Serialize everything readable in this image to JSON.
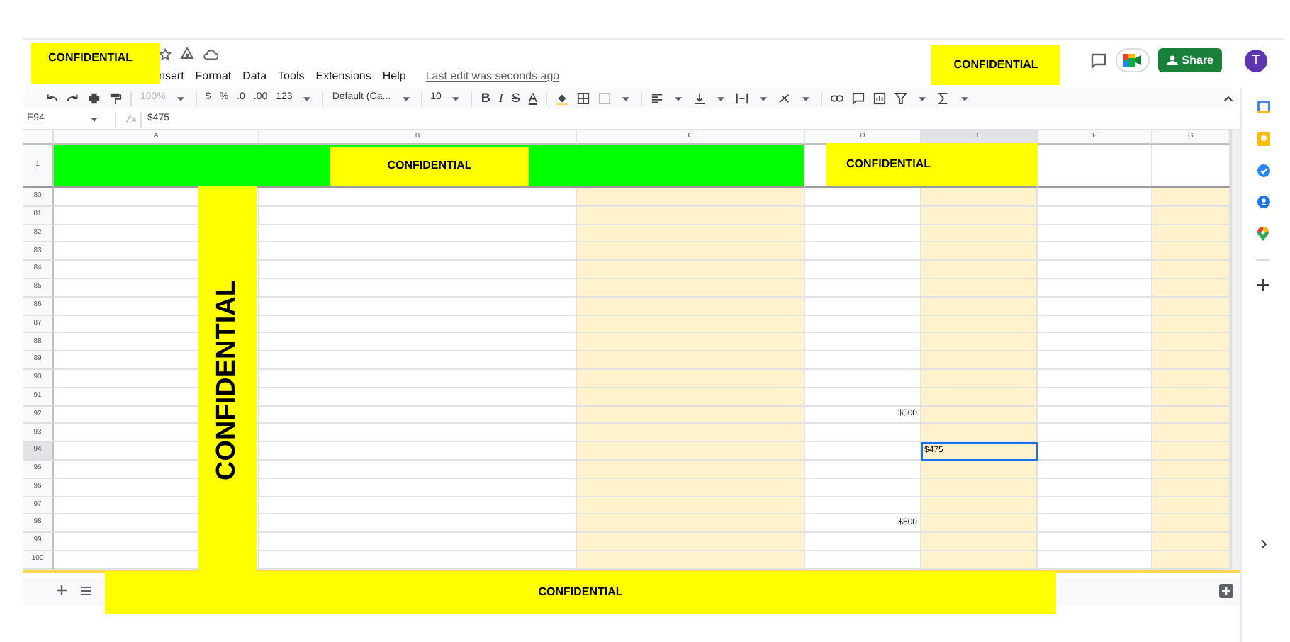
{
  "menu": [
    "nsert",
    "Format",
    "Data",
    "Tools",
    "Extensions",
    "Help"
  ],
  "last_edit": "Last edit was seconds ago",
  "share_button": "Share",
  "avatar": "T",
  "toolbar": {
    "zoom": "100%",
    "currency": "$",
    "percent": "%",
    "decrease_decimals": ".0",
    "increase_decimals": ".00",
    "number_format": "123",
    "font": "Default (Ca...",
    "font_size": "10",
    "bold": "B",
    "italic": "I",
    "strikethrough": "S",
    "text_color": "A"
  },
  "name_box": "E94",
  "formula": "$475",
  "columns": [
    {
      "label": "A",
      "color": "#ffffff",
      "selected": false
    },
    {
      "label": "B",
      "color": "#ffffff",
      "selected": false
    },
    {
      "label": "C",
      "color": "#fff2cc",
      "selected": false
    },
    {
      "label": "D",
      "color": "#ffffff",
      "selected": false
    },
    {
      "label": "E",
      "color": "#fff2cc",
      "selected": true
    },
    {
      "label": "F",
      "color": "#ffffff",
      "selected": false
    },
    {
      "label": "G",
      "color": "#fff2cc",
      "selected": false
    }
  ],
  "title_row": {
    "number": "1",
    "color": "#00ff00"
  },
  "rows": [
    {
      "number": "80",
      "selected": false,
      "cells": [
        {},
        {},
        {},
        {},
        {},
        {},
        {}
      ]
    },
    {
      "number": "81",
      "selected": false,
      "cells": [
        {},
        {},
        {},
        {},
        {},
        {},
        {}
      ]
    },
    {
      "number": "82",
      "selected": false,
      "cells": [
        {},
        {},
        {},
        {},
        {},
        {},
        {}
      ]
    },
    {
      "number": "83",
      "selected": false,
      "cells": [
        {},
        {},
        {},
        {},
        {},
        {},
        {}
      ]
    },
    {
      "number": "84",
      "selected": false,
      "cells": [
        {},
        {},
        {},
        {},
        {},
        {},
        {}
      ]
    },
    {
      "number": "85",
      "selected": false,
      "cells": [
        {},
        {},
        {},
        {},
        {},
        {},
        {}
      ]
    },
    {
      "number": "86",
      "selected": false,
      "cells": [
        {},
        {},
        {},
        {},
        {},
        {},
        {}
      ]
    },
    {
      "number": "87",
      "selected": false,
      "cells": [
        {},
        {},
        {},
        {},
        {},
        {},
        {}
      ]
    },
    {
      "number": "88",
      "selected": false,
      "cells": [
        {},
        {},
        {},
        {},
        {},
        {},
        {}
      ]
    },
    {
      "number": "89",
      "selected": false,
      "cells": [
        {},
        {},
        {},
        {},
        {},
        {},
        {}
      ]
    },
    {
      "number": "90",
      "selected": false,
      "cells": [
        {},
        {},
        {},
        {},
        {},
        {},
        {}
      ]
    },
    {
      "number": "91",
      "selected": false,
      "cells": [
        {},
        {},
        {},
        {},
        {},
        {},
        {}
      ]
    },
    {
      "number": "92",
      "selected": false,
      "cells": [
        {},
        {},
        {},
        {
          "text": "$500"
        },
        {},
        {},
        {}
      ]
    },
    {
      "number": "93",
      "selected": false,
      "cells": [
        {},
        {},
        {},
        {},
        {},
        {},
        {}
      ]
    },
    {
      "number": "94",
      "selected": true,
      "cells": [
        {},
        {},
        {},
        {},
        {
          "text": "$475",
          "selected": true
        },
        {},
        {}
      ]
    },
    {
      "number": "95",
      "selected": false,
      "cells": [
        {},
        {},
        {},
        {},
        {},
        {},
        {}
      ]
    },
    {
      "number": "96",
      "selected": false,
      "cells": [
        {},
        {},
        {},
        {},
        {},
        {},
        {}
      ]
    },
    {
      "number": "97",
      "selected": false,
      "cells": [
        {},
        {},
        {},
        {},
        {},
        {},
        {}
      ]
    },
    {
      "number": "98",
      "selected": false,
      "cells": [
        {},
        {},
        {},
        {
          "text": "$500"
        },
        {},
        {},
        {}
      ]
    },
    {
      "number": "99",
      "selected": false,
      "cells": [
        {},
        {},
        {},
        {},
        {},
        {},
        {}
      ]
    },
    {
      "number": "100",
      "selected": false,
      "cells": [
        {},
        {},
        {},
        {},
        {},
        {},
        {}
      ]
    }
  ],
  "redactions": [
    {
      "kind": "title",
      "text": "CONFIDENTIAL"
    },
    {
      "kind": "header",
      "text": "CONFIDENTIAL"
    },
    {
      "kind": "banner",
      "text": "CONFIDENTIAL"
    },
    {
      "kind": "banner-right",
      "text": "CONFIDENTIAL"
    },
    {
      "kind": "vertical",
      "text": "CONFIDENTIAL"
    },
    {
      "kind": "footer",
      "text": "CONFIDENTIAL"
    }
  ]
}
